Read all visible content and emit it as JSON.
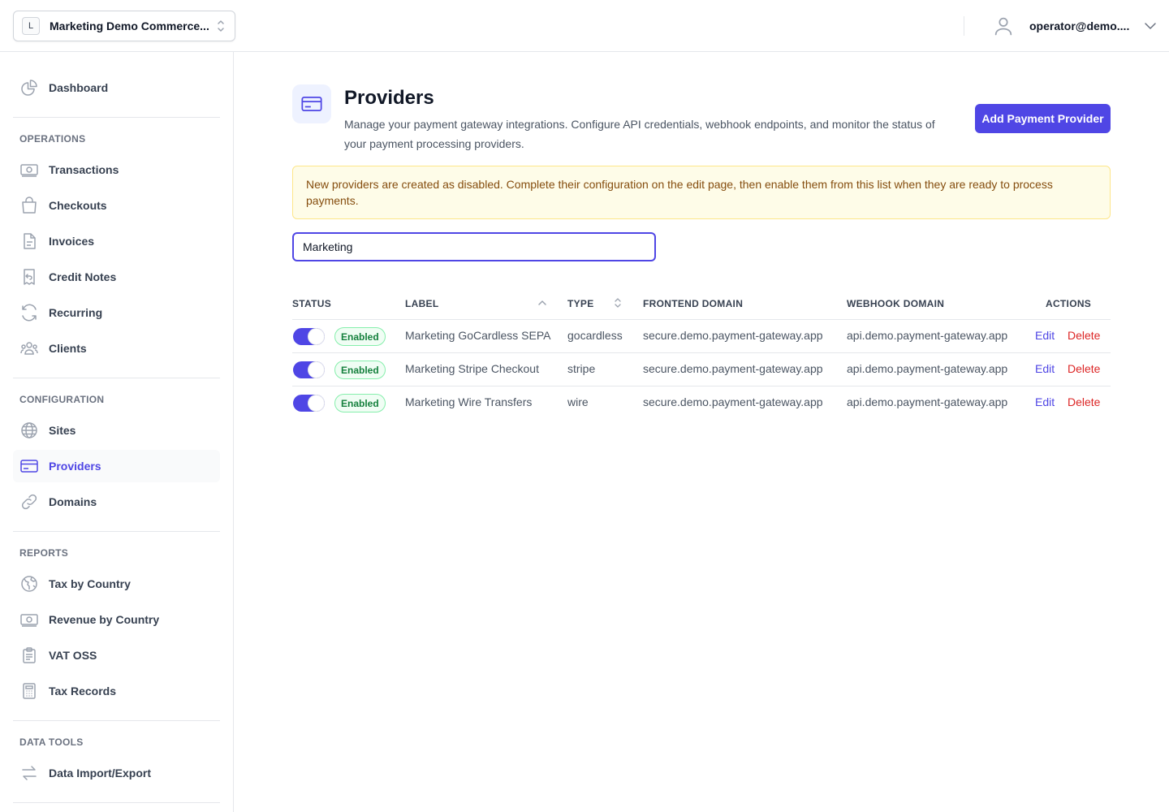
{
  "topbar": {
    "org_badge": "L",
    "org_name": "Marketing Demo Commerce...",
    "user_email": "operator@demo...."
  },
  "sidebar": {
    "dashboard": "Dashboard",
    "sections": {
      "operations": "OPERATIONS",
      "configuration": "CONFIGURATION",
      "reports": "REPORTS",
      "data_tools": "DATA TOOLS"
    },
    "items": {
      "transactions": "Transactions",
      "checkouts": "Checkouts",
      "invoices": "Invoices",
      "credit_notes": "Credit Notes",
      "recurring": "Recurring",
      "clients": "Clients",
      "sites": "Sites",
      "providers": "Providers",
      "domains": "Domains",
      "tax_by_country": "Tax by Country",
      "revenue_by_country": "Revenue by Country",
      "vat_oss": "VAT OSS",
      "tax_records": "Tax Records",
      "data_import_export": "Data Import/Export"
    }
  },
  "page": {
    "title": "Providers",
    "description": "Manage your payment gateway integrations. Configure API credentials, webhook endpoints, and monitor the status of your payment processing providers.",
    "add_button": "Add Payment Provider",
    "notice": "New providers are created as disabled. Complete their configuration on the edit page, then enable them from this list when they are ready to process payments.",
    "search_value": "Marketing"
  },
  "table": {
    "headers": {
      "status": "STATUS",
      "label": "LABEL",
      "type": "TYPE",
      "frontend_domain": "FRONTEND DOMAIN",
      "webhook_domain": "WEBHOOK DOMAIN",
      "actions": "ACTIONS"
    },
    "rows": [
      {
        "status": "Enabled",
        "label": "Marketing GoCardless SEPA",
        "type": "gocardless",
        "frontend": "secure.demo.payment-gateway.app",
        "webhook": "api.demo.payment-gateway.app",
        "edit": "Edit",
        "delete": "Delete"
      },
      {
        "status": "Enabled",
        "label": "Marketing Stripe Checkout",
        "type": "stripe",
        "frontend": "secure.demo.payment-gateway.app",
        "webhook": "api.demo.payment-gateway.app",
        "edit": "Edit",
        "delete": "Delete"
      },
      {
        "status": "Enabled",
        "label": "Marketing Wire Transfers",
        "type": "wire",
        "frontend": "secure.demo.payment-gateway.app",
        "webhook": "api.demo.payment-gateway.app",
        "edit": "Edit",
        "delete": "Delete"
      }
    ]
  },
  "colors": {
    "accent": "#4f46e5",
    "danger": "#dc2626",
    "success": "#15803d",
    "notice_bg": "#fefce8"
  }
}
